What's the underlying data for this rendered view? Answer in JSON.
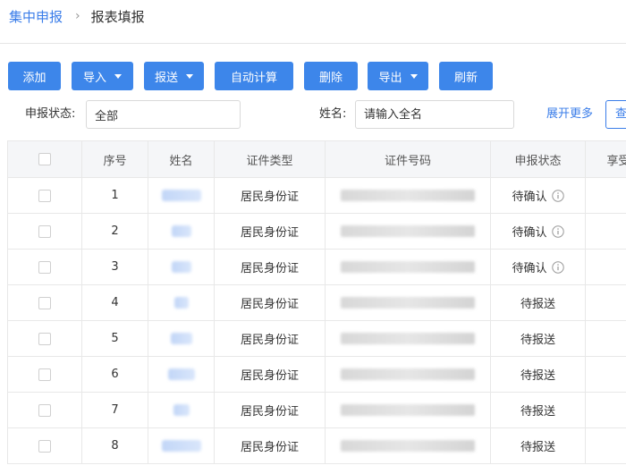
{
  "breadcrumb": {
    "parent": "集中申报",
    "separator": "›",
    "current": "报表填报"
  },
  "toolbar": {
    "buttons": [
      "添加",
      "导入",
      "报送",
      "自动计算",
      "删除",
      "导出",
      "刷新"
    ]
  },
  "filters": {
    "status_label": "申报状态:",
    "status_value": "全部",
    "name_label": "姓名:",
    "name_placeholder": "请输入全名",
    "expand_label": "展开更多",
    "query_label": "查询"
  },
  "table": {
    "columns": [
      "序号",
      "姓名",
      "证件类型",
      "证件号码",
      "申报状态",
      "享受"
    ],
    "rows": [
      {
        "index": "1",
        "id_type": "居民身份证",
        "status": "待确认",
        "has_info": true
      },
      {
        "index": "2",
        "id_type": "居民身份证",
        "status": "待确认",
        "has_info": true
      },
      {
        "index": "3",
        "id_type": "居民身份证",
        "status": "待确认",
        "has_info": true
      },
      {
        "index": "4",
        "id_type": "居民身份证",
        "status": "待报送",
        "has_info": false
      },
      {
        "index": "5",
        "id_type": "居民身份证",
        "status": "待报送",
        "has_info": false
      },
      {
        "index": "6",
        "id_type": "居民身份证",
        "status": "待报送",
        "has_info": false
      },
      {
        "index": "7",
        "id_type": "居民身份证",
        "status": "待报送",
        "has_info": false
      },
      {
        "index": "8",
        "id_type": "居民身份证",
        "status": "待报送",
        "has_info": false
      }
    ]
  },
  "icons": {
    "info": "info-circle-icon",
    "dropdown": "caret-down-icon",
    "checkbox": "checkbox-icon"
  },
  "colors": {
    "primary": "#3d86ea",
    "link": "#3a7de9",
    "header_bg": "#f5f6f8",
    "border": "#e8e8e8"
  }
}
